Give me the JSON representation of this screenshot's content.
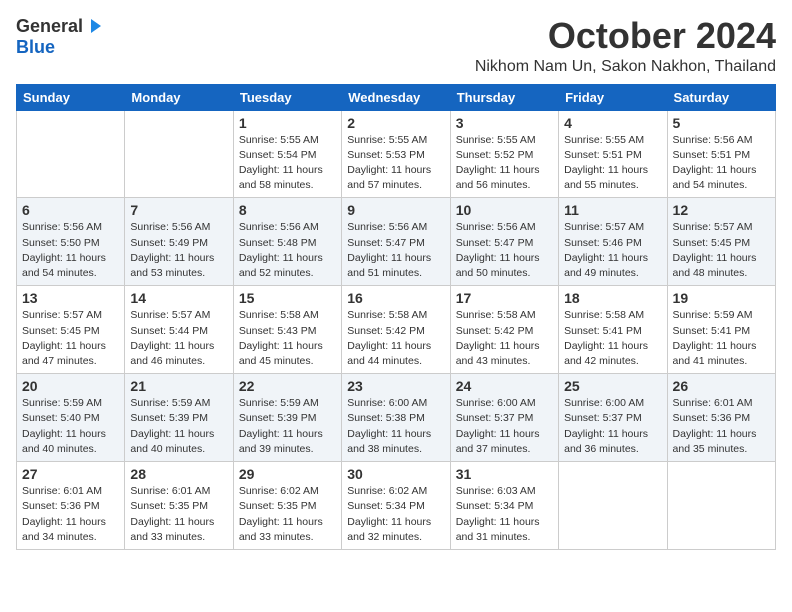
{
  "logo": {
    "general": "General",
    "blue": "Blue"
  },
  "title": "October 2024",
  "location": "Nikhom Nam Un, Sakon Nakhon, Thailand",
  "headers": [
    "Sunday",
    "Monday",
    "Tuesday",
    "Wednesday",
    "Thursday",
    "Friday",
    "Saturday"
  ],
  "weeks": [
    [
      {
        "day": "",
        "sunrise": "",
        "sunset": "",
        "daylight": ""
      },
      {
        "day": "",
        "sunrise": "",
        "sunset": "",
        "daylight": ""
      },
      {
        "day": "1",
        "sunrise": "Sunrise: 5:55 AM",
        "sunset": "Sunset: 5:54 PM",
        "daylight": "Daylight: 11 hours and 58 minutes."
      },
      {
        "day": "2",
        "sunrise": "Sunrise: 5:55 AM",
        "sunset": "Sunset: 5:53 PM",
        "daylight": "Daylight: 11 hours and 57 minutes."
      },
      {
        "day": "3",
        "sunrise": "Sunrise: 5:55 AM",
        "sunset": "Sunset: 5:52 PM",
        "daylight": "Daylight: 11 hours and 56 minutes."
      },
      {
        "day": "4",
        "sunrise": "Sunrise: 5:55 AM",
        "sunset": "Sunset: 5:51 PM",
        "daylight": "Daylight: 11 hours and 55 minutes."
      },
      {
        "day": "5",
        "sunrise": "Sunrise: 5:56 AM",
        "sunset": "Sunset: 5:51 PM",
        "daylight": "Daylight: 11 hours and 54 minutes."
      }
    ],
    [
      {
        "day": "6",
        "sunrise": "Sunrise: 5:56 AM",
        "sunset": "Sunset: 5:50 PM",
        "daylight": "Daylight: 11 hours and 54 minutes."
      },
      {
        "day": "7",
        "sunrise": "Sunrise: 5:56 AM",
        "sunset": "Sunset: 5:49 PM",
        "daylight": "Daylight: 11 hours and 53 minutes."
      },
      {
        "day": "8",
        "sunrise": "Sunrise: 5:56 AM",
        "sunset": "Sunset: 5:48 PM",
        "daylight": "Daylight: 11 hours and 52 minutes."
      },
      {
        "day": "9",
        "sunrise": "Sunrise: 5:56 AM",
        "sunset": "Sunset: 5:47 PM",
        "daylight": "Daylight: 11 hours and 51 minutes."
      },
      {
        "day": "10",
        "sunrise": "Sunrise: 5:56 AM",
        "sunset": "Sunset: 5:47 PM",
        "daylight": "Daylight: 11 hours and 50 minutes."
      },
      {
        "day": "11",
        "sunrise": "Sunrise: 5:57 AM",
        "sunset": "Sunset: 5:46 PM",
        "daylight": "Daylight: 11 hours and 49 minutes."
      },
      {
        "day": "12",
        "sunrise": "Sunrise: 5:57 AM",
        "sunset": "Sunset: 5:45 PM",
        "daylight": "Daylight: 11 hours and 48 minutes."
      }
    ],
    [
      {
        "day": "13",
        "sunrise": "Sunrise: 5:57 AM",
        "sunset": "Sunset: 5:45 PM",
        "daylight": "Daylight: 11 hours and 47 minutes."
      },
      {
        "day": "14",
        "sunrise": "Sunrise: 5:57 AM",
        "sunset": "Sunset: 5:44 PM",
        "daylight": "Daylight: 11 hours and 46 minutes."
      },
      {
        "day": "15",
        "sunrise": "Sunrise: 5:58 AM",
        "sunset": "Sunset: 5:43 PM",
        "daylight": "Daylight: 11 hours and 45 minutes."
      },
      {
        "day": "16",
        "sunrise": "Sunrise: 5:58 AM",
        "sunset": "Sunset: 5:42 PM",
        "daylight": "Daylight: 11 hours and 44 minutes."
      },
      {
        "day": "17",
        "sunrise": "Sunrise: 5:58 AM",
        "sunset": "Sunset: 5:42 PM",
        "daylight": "Daylight: 11 hours and 43 minutes."
      },
      {
        "day": "18",
        "sunrise": "Sunrise: 5:58 AM",
        "sunset": "Sunset: 5:41 PM",
        "daylight": "Daylight: 11 hours and 42 minutes."
      },
      {
        "day": "19",
        "sunrise": "Sunrise: 5:59 AM",
        "sunset": "Sunset: 5:41 PM",
        "daylight": "Daylight: 11 hours and 41 minutes."
      }
    ],
    [
      {
        "day": "20",
        "sunrise": "Sunrise: 5:59 AM",
        "sunset": "Sunset: 5:40 PM",
        "daylight": "Daylight: 11 hours and 40 minutes."
      },
      {
        "day": "21",
        "sunrise": "Sunrise: 5:59 AM",
        "sunset": "Sunset: 5:39 PM",
        "daylight": "Daylight: 11 hours and 40 minutes."
      },
      {
        "day": "22",
        "sunrise": "Sunrise: 5:59 AM",
        "sunset": "Sunset: 5:39 PM",
        "daylight": "Daylight: 11 hours and 39 minutes."
      },
      {
        "day": "23",
        "sunrise": "Sunrise: 6:00 AM",
        "sunset": "Sunset: 5:38 PM",
        "daylight": "Daylight: 11 hours and 38 minutes."
      },
      {
        "day": "24",
        "sunrise": "Sunrise: 6:00 AM",
        "sunset": "Sunset: 5:37 PM",
        "daylight": "Daylight: 11 hours and 37 minutes."
      },
      {
        "day": "25",
        "sunrise": "Sunrise: 6:00 AM",
        "sunset": "Sunset: 5:37 PM",
        "daylight": "Daylight: 11 hours and 36 minutes."
      },
      {
        "day": "26",
        "sunrise": "Sunrise: 6:01 AM",
        "sunset": "Sunset: 5:36 PM",
        "daylight": "Daylight: 11 hours and 35 minutes."
      }
    ],
    [
      {
        "day": "27",
        "sunrise": "Sunrise: 6:01 AM",
        "sunset": "Sunset: 5:36 PM",
        "daylight": "Daylight: 11 hours and 34 minutes."
      },
      {
        "day": "28",
        "sunrise": "Sunrise: 6:01 AM",
        "sunset": "Sunset: 5:35 PM",
        "daylight": "Daylight: 11 hours and 33 minutes."
      },
      {
        "day": "29",
        "sunrise": "Sunrise: 6:02 AM",
        "sunset": "Sunset: 5:35 PM",
        "daylight": "Daylight: 11 hours and 33 minutes."
      },
      {
        "day": "30",
        "sunrise": "Sunrise: 6:02 AM",
        "sunset": "Sunset: 5:34 PM",
        "daylight": "Daylight: 11 hours and 32 minutes."
      },
      {
        "day": "31",
        "sunrise": "Sunrise: 6:03 AM",
        "sunset": "Sunset: 5:34 PM",
        "daylight": "Daylight: 11 hours and 31 minutes."
      },
      {
        "day": "",
        "sunrise": "",
        "sunset": "",
        "daylight": ""
      },
      {
        "day": "",
        "sunrise": "",
        "sunset": "",
        "daylight": ""
      }
    ]
  ],
  "row_shaded": [
    false,
    true,
    false,
    true,
    false
  ]
}
